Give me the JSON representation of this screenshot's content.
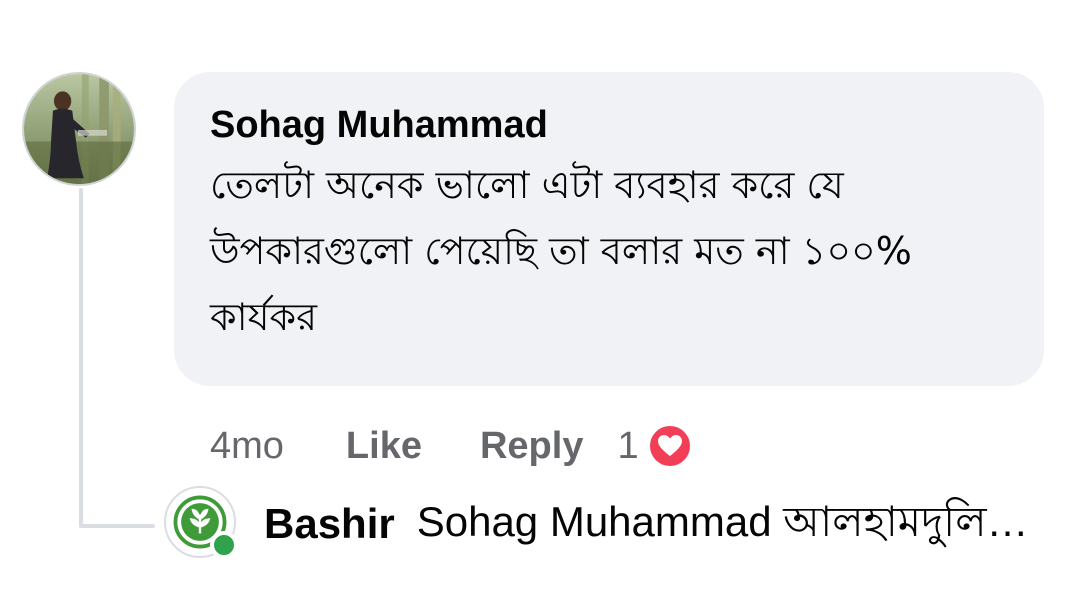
{
  "comment": {
    "author": "Sohag Muhammad",
    "text": "তেলটা অনেক ভালো এটা ব্যবহার করে যে উপকারগুলো পেয়েছি তা বলার মত না ১০০% কার্যকর",
    "avatar_icon": "profile-photo",
    "time": "4mo",
    "like_label": "Like",
    "reply_label": "Reply",
    "reaction_count": "1",
    "reaction_icon": "love-heart-icon",
    "reaction_color": "#f33e58"
  },
  "reply_preview": {
    "author": "Bashir",
    "snippet": "Sohag Muhammad আলহামদুলিল্লাহ",
    "avatar_icon": "leaf-logo-avatar",
    "online_status_color": "#31a24c"
  },
  "colors": {
    "bubble_bg": "#f0f2f5",
    "meta_text": "#65676b",
    "thread_line": "#dadde1"
  }
}
